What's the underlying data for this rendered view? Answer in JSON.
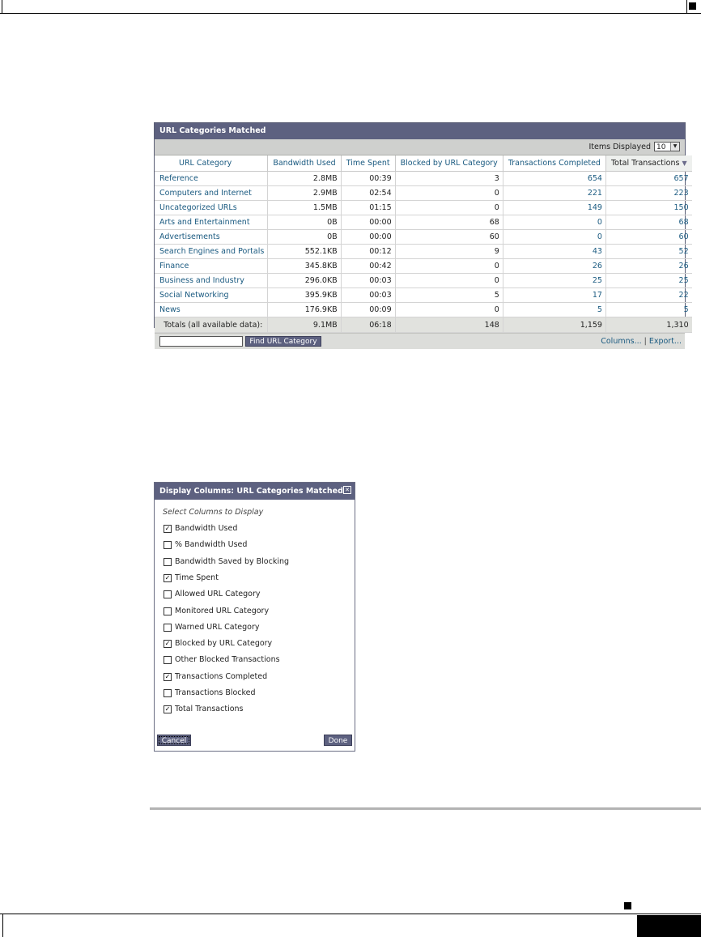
{
  "report": {
    "title": "URL Categories Matched",
    "items_displayed_label": "Items Displayed",
    "items_displayed_value": "10",
    "columns": [
      "URL Category",
      "Bandwidth Used",
      "Time Spent",
      "Blocked by URL Category",
      "Transactions Completed",
      "Total Transactions"
    ],
    "sorted_column": "Total Transactions",
    "rows": [
      {
        "category": "Reference",
        "bandwidth": "2.8MB",
        "time": "00:39",
        "blocked": "3",
        "completed": "654",
        "total": "657"
      },
      {
        "category": "Computers and Internet",
        "bandwidth": "2.9MB",
        "time": "02:54",
        "blocked": "0",
        "completed": "221",
        "total": "223"
      },
      {
        "category": "Uncategorized URLs",
        "bandwidth": "1.5MB",
        "time": "01:15",
        "blocked": "0",
        "completed": "149",
        "total": "150"
      },
      {
        "category": "Arts and Entertainment",
        "bandwidth": "0B",
        "time": "00:00",
        "blocked": "68",
        "completed": "0",
        "total": "68"
      },
      {
        "category": "Advertisements",
        "bandwidth": "0B",
        "time": "00:00",
        "blocked": "60",
        "completed": "0",
        "total": "60"
      },
      {
        "category": "Search Engines and Portals",
        "bandwidth": "552.1KB",
        "time": "00:12",
        "blocked": "9",
        "completed": "43",
        "total": "52"
      },
      {
        "category": "Finance",
        "bandwidth": "345.8KB",
        "time": "00:42",
        "blocked": "0",
        "completed": "26",
        "total": "26"
      },
      {
        "category": "Business and Industry",
        "bandwidth": "296.0KB",
        "time": "00:03",
        "blocked": "0",
        "completed": "25",
        "total": "25"
      },
      {
        "category": "Social Networking",
        "bandwidth": "395.9KB",
        "time": "00:03",
        "blocked": "5",
        "completed": "17",
        "total": "22"
      },
      {
        "category": "News",
        "bandwidth": "176.9KB",
        "time": "00:09",
        "blocked": "0",
        "completed": "5",
        "total": "5"
      }
    ],
    "totals": {
      "label": "Totals (all available data):",
      "bandwidth": "9.1MB",
      "time": "06:18",
      "blocked": "148",
      "completed": "1,159",
      "total": "1,310"
    },
    "find_button": "Find URL Category",
    "find_value": "",
    "columns_link": "Columns...",
    "export_link": "Export..."
  },
  "dialog": {
    "title": "Display Columns: URL Categories Matched",
    "subtitle": "Select Columns to Display",
    "options": [
      {
        "label": "Bandwidth Used",
        "checked": true
      },
      {
        "label": "% Bandwidth Used",
        "checked": false
      },
      {
        "label": "Bandwidth Saved by Blocking",
        "checked": false
      },
      {
        "label": "Time Spent",
        "checked": true
      },
      {
        "label": "Allowed URL Category",
        "checked": false
      },
      {
        "label": "Monitored URL Category",
        "checked": false
      },
      {
        "label": "Warned URL Category",
        "checked": false
      },
      {
        "label": "Blocked by URL Category",
        "checked": true
      },
      {
        "label": "Other Blocked Transactions",
        "checked": false
      },
      {
        "label": "Transactions Completed",
        "checked": true
      },
      {
        "label": "Transactions Blocked",
        "checked": false
      },
      {
        "label": "Total Transactions",
        "checked": true
      }
    ],
    "cancel_label": "Cancel",
    "done_label": "Done"
  }
}
